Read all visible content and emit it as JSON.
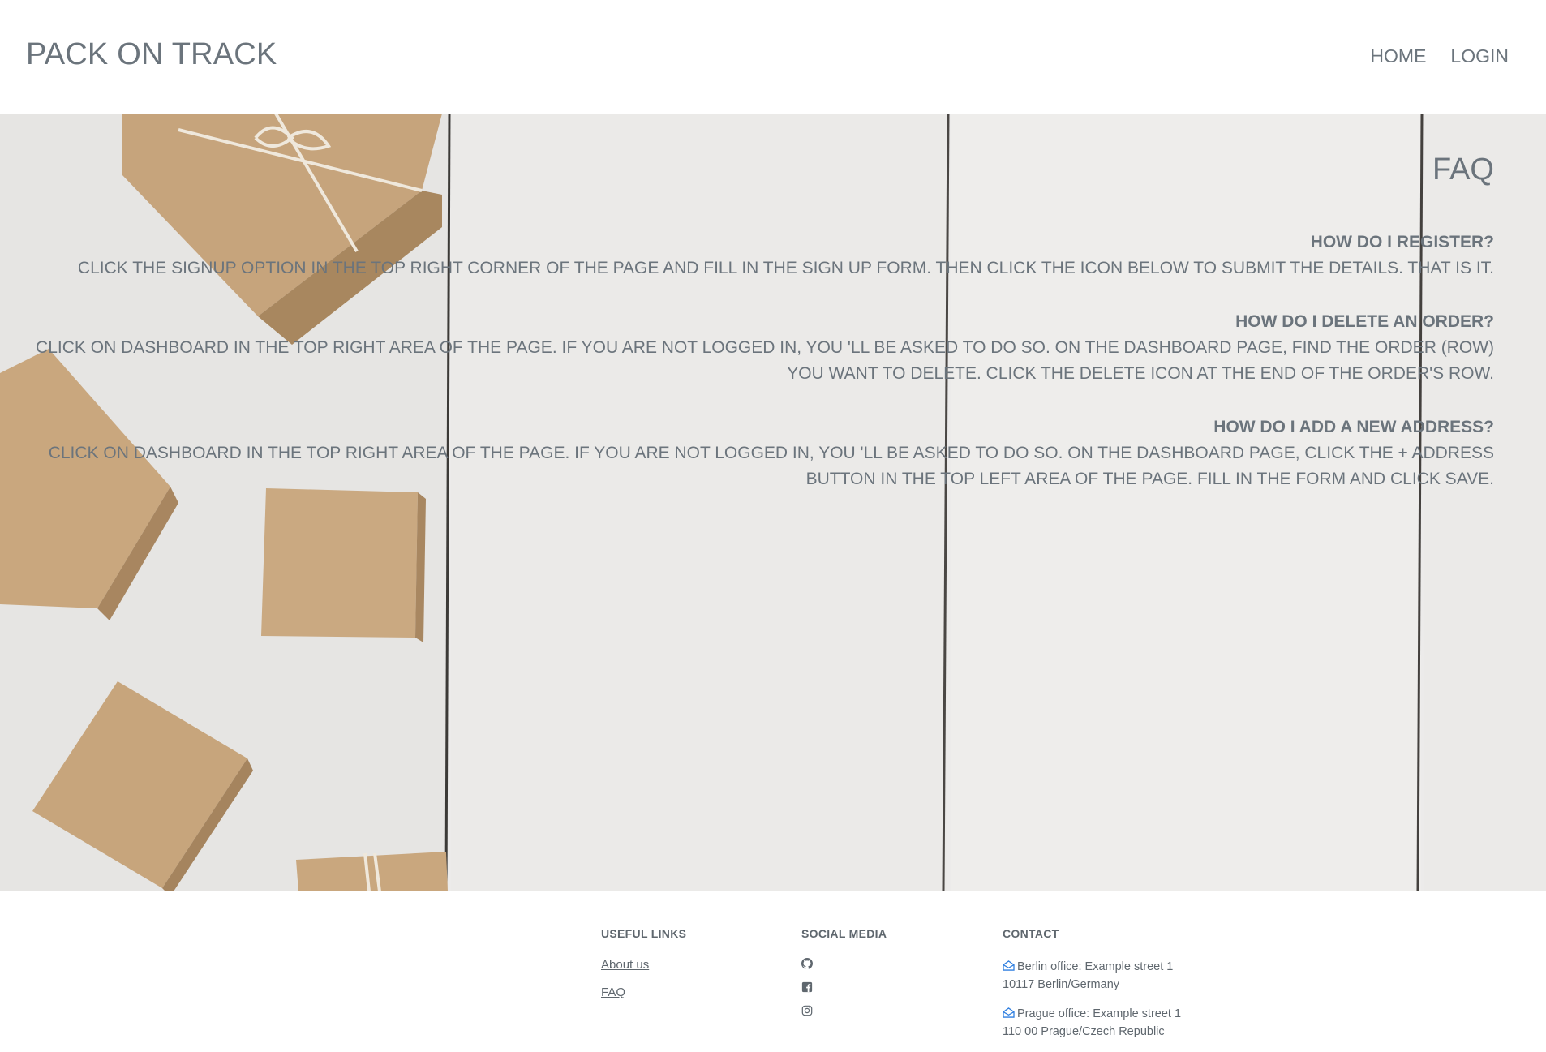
{
  "header": {
    "brand": "PACK ON TRACK",
    "nav": {
      "home": "HOME",
      "login": "LOGIN"
    }
  },
  "hero": {
    "title": "FAQ",
    "faqs": [
      {
        "question": "HOW DO I REGISTER?",
        "answer": "CLICK THE SIGNUP OPTION IN THE TOP RIGHT CORNER OF THE PAGE AND FILL IN THE SIGN UP FORM. THEN CLICK THE ICON BELOW TO SUBMIT THE DETAILS. THAT IS IT."
      },
      {
        "question": "HOW DO I DELETE AN ORDER?",
        "answer": "CLICK ON DASHBOARD IN THE TOP RIGHT AREA OF THE PAGE. IF YOU ARE NOT LOGGED IN, YOU 'LL BE ASKED TO DO SO. ON THE DASHBOARD PAGE, FIND THE ORDER (ROW) YOU WANT TO DELETE. CLICK THE DELETE ICON AT THE END OF THE ORDER'S ROW."
      },
      {
        "question": "HOW DO I ADD A NEW ADDRESS?",
        "answer": "CLICK ON DASHBOARD IN THE TOP RIGHT AREA OF THE PAGE. IF YOU ARE NOT LOGGED IN, YOU 'LL BE ASKED TO DO SO. ON THE DASHBOARD PAGE, CLICK THE + ADDRESS BUTTON IN THE TOP LEFT AREA OF THE PAGE. FILL IN THE FORM AND CLICK SAVE."
      }
    ]
  },
  "footer": {
    "useful_links": {
      "heading": "USEFUL LINKS",
      "items": [
        "About us",
        "FAQ"
      ]
    },
    "social_media": {
      "heading": "SOCIAL MEDIA",
      "icons": [
        "github-icon",
        "facebook-icon",
        "instagram-icon"
      ]
    },
    "contact": {
      "heading": "CONTACT",
      "offices": [
        {
          "line1": "Berlin office: Example street 1",
          "line2": "10117 Berlin/Germany"
        },
        {
          "line1": "Prague office: Example street 1",
          "line2": "110 00 Prague/Czech Republic"
        }
      ]
    }
  },
  "colors": {
    "text": "#6c757d",
    "accent_icon": "#2f7fe0",
    "box": "#c9a77e",
    "background_wood": "#ebebea"
  }
}
